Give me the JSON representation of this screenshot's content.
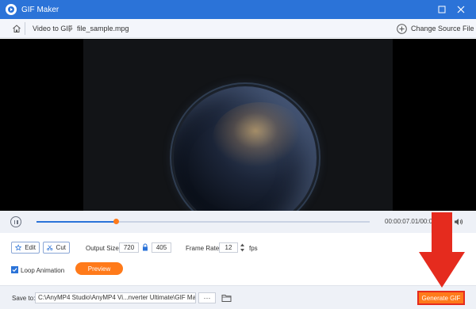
{
  "window": {
    "title": "GIF Maker",
    "maximize_icon": "maximize-icon",
    "close_icon": "close-icon"
  },
  "breadcrumb": {
    "home_icon": "home-icon",
    "items": [
      "Video to GIF",
      "file_sample.mpg"
    ],
    "change_source_label": "Change Source File"
  },
  "playback": {
    "progress_fraction": 0.24,
    "time_text": "00:00:07.01/00:00:30.00"
  },
  "settings": {
    "edit_label": "Edit",
    "cut_label": "Cut",
    "output_size_label": "Output Size:",
    "width": "720",
    "height": "405",
    "frame_rate_label": "Frame Rate:",
    "frame_rate": "12",
    "fps_label": "fps",
    "loop_label": "Loop Animation",
    "loop_checked": true,
    "preview_label": "Preview"
  },
  "save": {
    "label": "Save to:",
    "path": "C:\\AnyMP4 Studio\\AnyMP4 Vi...nverter Ultimate\\GIF Maker",
    "more_label": "···",
    "generate_label": "Generate GIF"
  },
  "colors": {
    "accent_blue": "#2b73d8",
    "orange": "#ff7a1a",
    "annotation_red": "#e52b1e"
  }
}
